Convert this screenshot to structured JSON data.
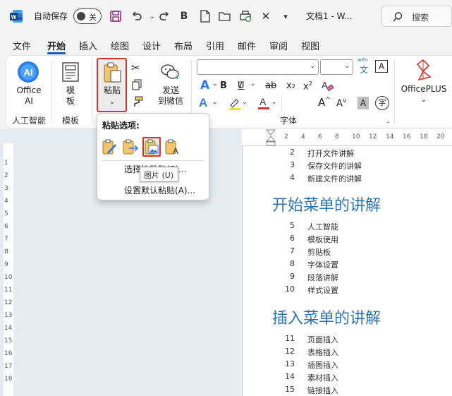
{
  "titlebar": {
    "autosave_label": "自动保存",
    "autosave_state": "关",
    "doc_title": "文档1 - W...",
    "search_placeholder": "搜索"
  },
  "tabs": [
    "文件",
    "开始",
    "插入",
    "绘图",
    "设计",
    "布局",
    "引用",
    "邮件",
    "审阅",
    "视图"
  ],
  "active_tab": "开始",
  "ribbon": {
    "office_ai": "Office\nAI",
    "office_ai_line1": "Office",
    "office_ai_line2": "AI",
    "template_line1": "模",
    "template_line2": "板",
    "paste": "粘贴",
    "send_wechat_line1": "发送",
    "send_wechat_line2": "到微信",
    "officeplus": "OfficePLUS",
    "wen": "wén",
    "groups": {
      "ai": "人工智能",
      "template": "模板",
      "font": "字体"
    }
  },
  "paste_menu": {
    "title": "粘贴选项:",
    "selective_paste": "选择性粘贴(S)...",
    "set_default_paste": "设置默认粘贴(A)...",
    "tooltip": "图片 (U)"
  },
  "hruler_numbers": [
    "2",
    "4",
    "6",
    "8",
    "10",
    "12",
    "14",
    "16",
    "18",
    "20"
  ],
  "vruler_numbers": [
    "1",
    "2",
    "3",
    "4",
    "5",
    "6",
    "7",
    "8",
    "9",
    "10",
    "11",
    "12",
    "13",
    "14",
    "15",
    "16",
    "17",
    "18"
  ],
  "document": {
    "toc_top": [
      {
        "num": "2",
        "text": "打开文件讲解"
      },
      {
        "num": "3",
        "text": "保存文件的讲解"
      },
      {
        "num": "4",
        "text": "新建文件的讲解"
      }
    ],
    "heading1": "开始菜单的讲解",
    "toc_mid": [
      {
        "num": "5",
        "text": "人工智能"
      },
      {
        "num": "6",
        "text": "模板使用"
      },
      {
        "num": "7",
        "text": "剪贴板"
      },
      {
        "num": "8",
        "text": "字体设置"
      },
      {
        "num": "9",
        "text": "段落讲解"
      },
      {
        "num": "10",
        "text": "样式设置"
      }
    ],
    "heading2": "插入菜单的讲解",
    "toc_bottom": [
      {
        "num": "11",
        "text": "页面插入"
      },
      {
        "num": "12",
        "text": "表格插入"
      },
      {
        "num": "13",
        "text": "插图插入"
      },
      {
        "num": "14",
        "text": "素材插入"
      },
      {
        "num": "15",
        "text": "链接插入"
      }
    ]
  },
  "colors": {
    "accent": "#185abd",
    "highlight_red": "#d9342b",
    "heading_blue": "#2e74b5"
  }
}
